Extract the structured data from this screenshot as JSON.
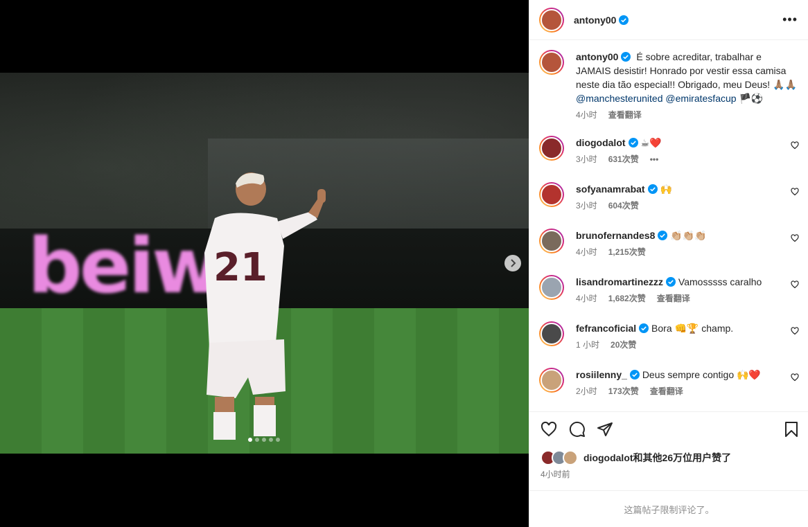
{
  "post": {
    "username": "antony00",
    "caption_username": "antony00",
    "caption_text": "É sobre acreditar, trabalhar e JAMAIS desistir! Honrado por vestir essa camisa neste dia tão especial!! Obrigado, meu Deus! 🙏🏽🙏🏽",
    "mention_1": "@manchesterunited",
    "mention_2": "@emiratesfacup",
    "caption_emoji": "🏴⚽",
    "caption_time": "4小时",
    "caption_translate": "查看翻译",
    "image_text": "beiwa",
    "carousel": {
      "slides": 5,
      "current": 1
    }
  },
  "comments": [
    {
      "username": "diogodalot",
      "text": "☕❤️",
      "time": "3小时",
      "likes": "631次赞",
      "extra": "•••",
      "avatar_color": "#8a2a2a"
    },
    {
      "username": "sofyanamrabat",
      "text": "🙌",
      "time": "3小时",
      "likes": "604次赞",
      "extra": "",
      "avatar_color": "#b3332e"
    },
    {
      "username": "brunofernandes8",
      "text": "👏🏼👏🏼👏🏼",
      "time": "4小时",
      "likes": "1,215次赞",
      "extra": "",
      "avatar_color": "#7a6a5c"
    },
    {
      "username": "lisandromartinezzz",
      "text": "Vamosssss caralho",
      "time": "4小时",
      "likes": "1,682次赞",
      "extra": "查看翻译",
      "avatar_color": "#9aa4b0"
    },
    {
      "username": "fefrancoficial",
      "text": "Bora 👊🏆 champ.",
      "time": "1 小时",
      "likes": "20次赞",
      "extra": "",
      "avatar_color": "#4a4a4a"
    },
    {
      "username": "rosiilenny_",
      "text": "Deus sempre contigo 🙌❤️",
      "time": "2小时",
      "likes": "173次赞",
      "extra": "查看翻译",
      "avatar_color": "#c9a27a"
    }
  ],
  "likes_text": "diogodalot和其他26万位用户赞了",
  "post_time": "4小时前",
  "comments_limited": "这篇帖子限制评论了。",
  "colors": {
    "verified": "#0095f6",
    "link": "#00376b",
    "muted": "#737373"
  }
}
